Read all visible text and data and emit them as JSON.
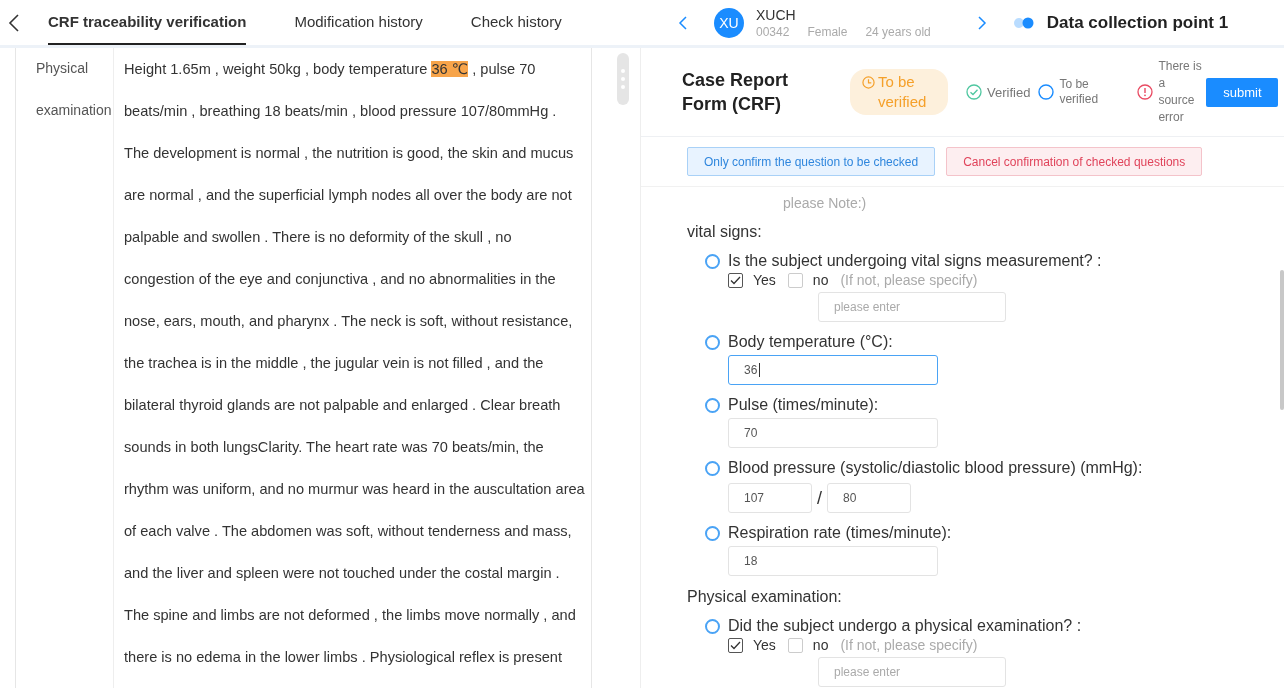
{
  "tabs": [
    {
      "label": "CRF traceability verification",
      "selected": true
    },
    {
      "label": "Modification history",
      "selected": false
    },
    {
      "label": "Check history",
      "selected": false
    }
  ],
  "patient": {
    "avatar": "XU",
    "name": "XUCH",
    "id": "00342",
    "sex": "Female",
    "age": "24 years old"
  },
  "collection_point": "Data collection point 1",
  "source": {
    "label": "Physical examination",
    "segments": [
      {
        "text": "Height 1.65m , weight 50kg , body temperature ",
        "highlighted": false
      },
      {
        "text": "36 ℃",
        "highlighted": true
      },
      {
        "text": " , pulse 70 beats/min , breathing 18 beats/min , blood pressure 107/80mmHg . The development is normal , the nutrition is good, the skin and mucus are normal , and the superficial lymph nodes all over the body are not palpable and swollen . There is no deformity of the skull , no congestion of the eye and conjunctiva , and no abnormalities in the nose, ears, mouth, and pharynx . The neck is soft, without resistance, the trachea is in the middle , the jugular vein is not filled , and the bilateral thyroid glands are not palpable and enlarged . Clear breath sounds in both lungsClarity. The heart rate was 70 beats/min, the rhythm was uniform, and no murmur was heard in the auscultation area of each valve . The abdomen was soft, without tenderness and mass, and the liver and spleen were not touched under the costal margin . The spine and limbs are not deformed , the limbs move normally , and there is no edema in the lower limbs . Physiological reflex is present",
        "highlighted": false
      }
    ]
  },
  "crf": {
    "title": "Case Report Form (CRF)",
    "status": "To be verified",
    "legend": [
      {
        "kind": "verified",
        "label": "Verified"
      },
      {
        "kind": "pending",
        "label": "To be verified"
      },
      {
        "kind": "error",
        "label": "There is a source error"
      }
    ],
    "submit": "submit",
    "actions": [
      {
        "kind": "confirm",
        "label": "Only confirm the question to be checked"
      },
      {
        "kind": "cancel",
        "label": "Cancel confirmation of checked questions"
      }
    ],
    "note": "please Note:)",
    "sections": [
      {
        "title": "vital signs:",
        "questions": [
          {
            "kind": "yesno",
            "checked": false,
            "label": "Is the subject undergoing vital signs measurement? :",
            "yes": "Yes",
            "yes_checked": true,
            "no": "no",
            "no_checked": false,
            "hint": "(If not, please specify)",
            "placeholder": "please enter"
          },
          {
            "kind": "input",
            "checked": false,
            "label": "Body temperature (°C):",
            "value": "36",
            "focused": true
          },
          {
            "kind": "input",
            "checked": false,
            "label": "Pulse (times/minute):",
            "value": "70",
            "focused": false
          },
          {
            "kind": "pair",
            "checked": false,
            "label": "Blood pressure (systolic/diastolic blood pressure) (mmHg):",
            "values": [
              "107",
              "80"
            ],
            "separator": "/"
          },
          {
            "kind": "input",
            "checked": false,
            "label": "Respiration rate (times/minute):",
            "value": "18",
            "focused": false
          }
        ]
      },
      {
        "title": "Physical examination:",
        "questions": [
          {
            "kind": "yesno",
            "checked": false,
            "label": "Did the subject undergo a physical examination? :",
            "yes": "Yes",
            "yes_checked": true,
            "no": "no",
            "no_checked": false,
            "hint": "(If not, please specify)",
            "placeholder": "please enter"
          }
        ]
      }
    ]
  }
}
